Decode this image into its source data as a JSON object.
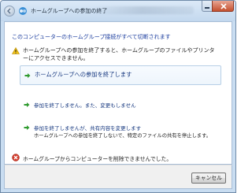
{
  "window": {
    "title": "ホームグループへの参加の終了"
  },
  "dialog": {
    "main_instruction": "このコンピューターのホームグループ接続がすべて切断されます",
    "warning_text": "ホームグループへの参加を終了すると、ホームグループのファイルやプリンターにアクセスできません。",
    "commands": [
      {
        "label": "ホームグループへの参加を終了します",
        "description": ""
      },
      {
        "label": "参加を終了しません。また、変更もしません",
        "description": ""
      },
      {
        "label": "参加を終了しませんが、共有内容を変更します",
        "description": "ホームグループへの参加を終了しないで、特定のファイルの共有を停止します。"
      }
    ],
    "error_text": "ホームグループからコンピューターを削除できませんでした。",
    "cancel_label": "キャンセル"
  },
  "icons": {
    "back": "back-arrow-icon",
    "homegroup": "homegroup-icon",
    "warning": "warning-icon",
    "command_arrow": "green-arrow-icon",
    "error": "error-icon",
    "minimize": "minimize-icon",
    "close": "close-icon"
  },
  "colors": {
    "instruction_blue": "#1b3d9e",
    "command_blue": "#15377f",
    "arrow_green": "#2e9a2e",
    "error_red": "#d13b2b",
    "warning_yellow": "#f2c316"
  }
}
